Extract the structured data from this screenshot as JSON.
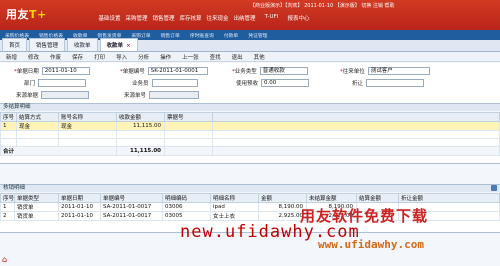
{
  "top": {
    "logo_prefix": "用友",
    "logo_suffix": "T+",
    "status": "【商业版演示】【刘欢】 2011-01-10 【演示版】 切换 注销 帮助",
    "menu": [
      "基础设置",
      "采购管理",
      "销售管理",
      "库存核算",
      "往来现金",
      "出纳管理",
      "T-UFI",
      "报表中心"
    ]
  },
  "subnav": [
    "采购价格表",
    "销售价格表",
    "收款单",
    "销售发货单",
    "采购订单",
    "销售订单",
    "序时账查询",
    "付款单",
    "凭证管理"
  ],
  "tabs": [
    {
      "label": "首页"
    },
    {
      "label": "销售管理"
    },
    {
      "label": "收款单"
    },
    {
      "label": "收款单",
      "active": true
    }
  ],
  "toolbar": [
    "新增",
    "修改",
    "作废",
    "保存",
    "打印",
    "导入",
    "分析",
    "操作",
    "上一张",
    "查找",
    "退出",
    "其他"
  ],
  "form": {
    "doc_date_label": "单据日期",
    "doc_date_value": "2011-01-10",
    "doc_no_label": "单据编号",
    "doc_no_value": "SK-2011-01-0001",
    "biz_type_label": "业务类型",
    "biz_type_value": "普通收款",
    "customer_label": "往来单位",
    "customer_value": "测试客户",
    "dept_label": "部门",
    "dept_value": "",
    "salesman_label": "业务员",
    "salesman_value": "",
    "prepay_label": "使用预收",
    "prepay_value": "0.00",
    "discount_label": "折让",
    "discount_value": "",
    "source_label": "来源单据",
    "source_value": "",
    "source_no_label": "来源单号",
    "source_no_value": ""
  },
  "settle": {
    "section_title": "多结算明细",
    "headers": [
      "序号",
      "结算方式",
      "账号名称",
      "收款金额",
      "票据号"
    ],
    "rows": [
      {
        "no": "1",
        "method": "现金",
        "account": "现金",
        "amount": "11,115.00",
        "ticket": ""
      }
    ],
    "total_label": "合计",
    "total_amount": "11,115.00"
  },
  "verify": {
    "section_title": "核销明细",
    "headers": [
      "序号",
      "单据类型",
      "单据日期",
      "单据编号",
      "明细编码",
      "明细名称",
      "金额",
      "未结算金额",
      "结算金额",
      "折让金额"
    ],
    "rows": [
      {
        "no": "1",
        "type": "销货单",
        "date": "2011-01-10",
        "code": "SA-2011-01-0017",
        "item_code": "03006",
        "item_name": "ipad",
        "amount": "8,190.00",
        "unsettled": "8,190.00",
        "settled": "",
        "discount": ""
      },
      {
        "no": "2",
        "type": "销货单",
        "date": "2011-01-10",
        "code": "SA-2011-01-0017",
        "item_code": "03005",
        "item_name": "女士上衣",
        "amount": "2,925.00",
        "unsettled": "2,925.00",
        "settled": "",
        "discount": ""
      }
    ]
  },
  "watermark": {
    "line1": "new.ufidawhy.com",
    "line2": "用友软件免费下载",
    "line3": "www.ufidawhy.com"
  }
}
